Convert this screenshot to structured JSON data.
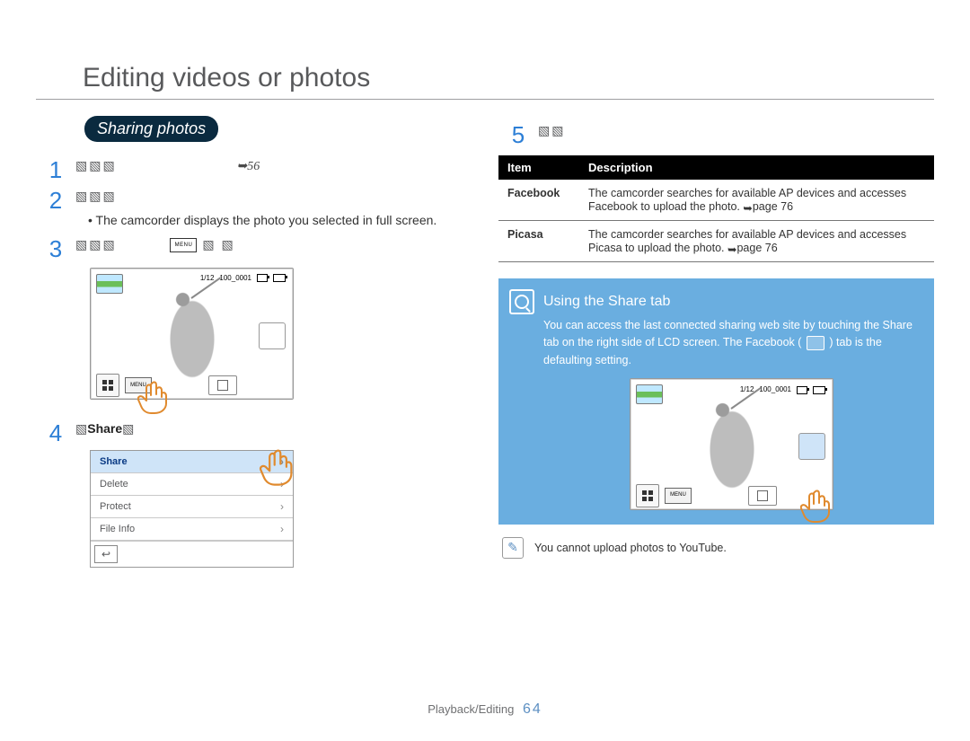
{
  "title": "Editing videos or photos",
  "pill": "Sharing photos",
  "page_ref_glyph": "➥",
  "steps": {
    "left": [
      {
        "num": "1",
        "placeholder_pre": "▧▧▧",
        "page_ref": "56"
      },
      {
        "num": "2",
        "placeholder_pre": "▧▧▧",
        "bullet": "The camcorder displays the photo you selected in full screen."
      },
      {
        "num": "3",
        "placeholder_pre": "▧▧▧",
        "menu_label": "MENU",
        "placeholder_post": "▧  ▧"
      },
      {
        "num": "4",
        "share_label_pre": "▧",
        "share_label": "Share",
        "share_label_post": "▧"
      }
    ],
    "right": {
      "num": "5",
      "placeholder": "▧▧"
    }
  },
  "cam": {
    "counter": "1/12",
    "filecode": "100_0001",
    "menu_tile": "MENU"
  },
  "menu_list": {
    "items": [
      {
        "label": "Share",
        "selected": true
      },
      {
        "label": "Delete"
      },
      {
        "label": "Protect"
      },
      {
        "label": "File Info"
      }
    ],
    "back_glyph": "↩"
  },
  "table": {
    "head": {
      "item": "Item",
      "desc": "Description"
    },
    "rows": [
      {
        "key": "Facebook",
        "desc": "The camcorder searches for available AP devices and accesses Facebook to upload the photo.",
        "page_ref": "page 76"
      },
      {
        "key": "Picasa",
        "desc": "The camcorder searches for available AP devices and accesses Picasa to upload the photo.",
        "page_ref": "page 76"
      }
    ]
  },
  "info": {
    "title": "Using the Share tab",
    "body_a": "You can access the last connected sharing web site by touching the Share tab on the right side of LCD screen. The Facebook (",
    "body_b": ") tab is the defaulting setting."
  },
  "note": "You cannot upload photos to YouTube.",
  "footer": {
    "section": "Playback/Editing",
    "page": "64"
  }
}
